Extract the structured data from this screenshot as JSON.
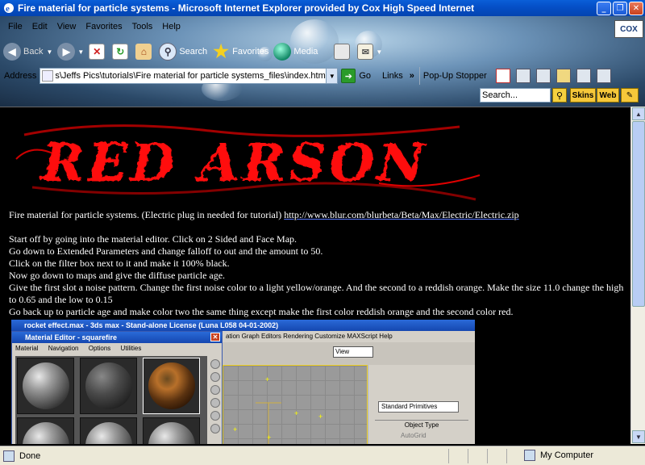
{
  "window": {
    "title": "Fire material for particle systems - Microsoft Internet Explorer provided by Cox High Speed Internet"
  },
  "menubar": {
    "items": [
      "File",
      "Edit",
      "View",
      "Favorites",
      "Tools",
      "Help"
    ],
    "logo": "COX"
  },
  "toolbar": {
    "back": "Back",
    "search": "Search",
    "favorites": "Favorites",
    "media": "Media"
  },
  "addressbar": {
    "label": "Address",
    "value": "s\\Jeffs Pics\\tutorials\\Fire material for particle systems_files\\index.htm",
    "go": "Go",
    "links": "Links",
    "chevron": "»",
    "popup": "Pop-Up Stopper"
  },
  "searchbar": {
    "placeholder": "Search...",
    "skins": "Skins",
    "web": "Web"
  },
  "page": {
    "intro": "Fire material for particle systems.   (Electric plug in needed for tutorial) ",
    "link": "http://www.blur.com/blurbeta/Beta/Max/Electric/Electric.zip",
    "steps": [
      "Start off by going into the material editor. Click on 2 Sided and Face Map.",
      "Go down to Extended Parameters and change falloff to out and the amount to 50.",
      "Click on the filter box next to it and make it 100% black.",
      "Now go down to maps and give the diffuse particle age.",
      "Give the first slot a noise pattern. Change the first noise color to a light yellow/orange. And the second to a reddish orange. Make the size 11.0 change the high to 0.65 and the low to 0.15",
      "Go back up to particle age and make color two the same thing except make the first color reddish orange and the second color red."
    ],
    "logo_text": "RED ARSON"
  },
  "screenshot": {
    "main_title": "rocket effect.max - 3ds max - Stand-alone License (Luna L058 04-01-2002)",
    "main_menu": "ation   Graph Editors   Rendering   Customize   MAXScript   Help",
    "view_label": "View",
    "editor_title": "Material Editor - squarefire",
    "editor_menu": [
      "Material",
      "Navigation",
      "Options",
      "Utilities"
    ],
    "dropdown": "Standard Primitives",
    "object_type": "Object Type",
    "autogrid": "AutoGrid"
  },
  "statusbar": {
    "status": "Done",
    "zone": "My Computer"
  }
}
